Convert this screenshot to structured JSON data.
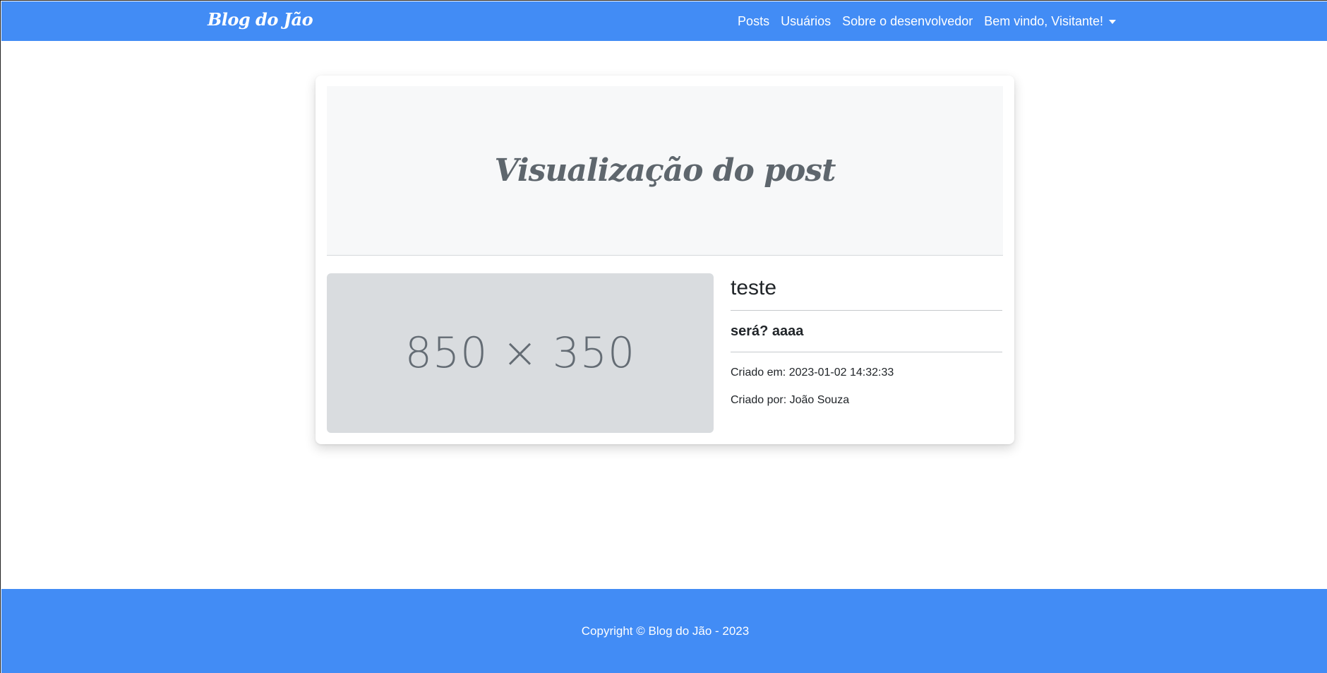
{
  "navbar": {
    "brand": "Blog do Jão",
    "links": [
      "Posts",
      "Usuários",
      "Sobre o desenvolvedor"
    ],
    "user_menu": "Bem vindo, Visitante!",
    "color": "#428cf5"
  },
  "card": {
    "header_title": "Visualização do post",
    "image_placeholder": "850 × 350",
    "post": {
      "title": "teste",
      "subtitle": "será? aaaa",
      "created_at": "Criado em: 2023-01-02 14:32:33",
      "created_by": "Criado por: João Souza"
    }
  },
  "footer": {
    "text": "Copyright © Blog do Jão - 2023",
    "color": "#428cf5"
  },
  "icons": {
    "user_menu_caret": "chevron-down-icon"
  }
}
